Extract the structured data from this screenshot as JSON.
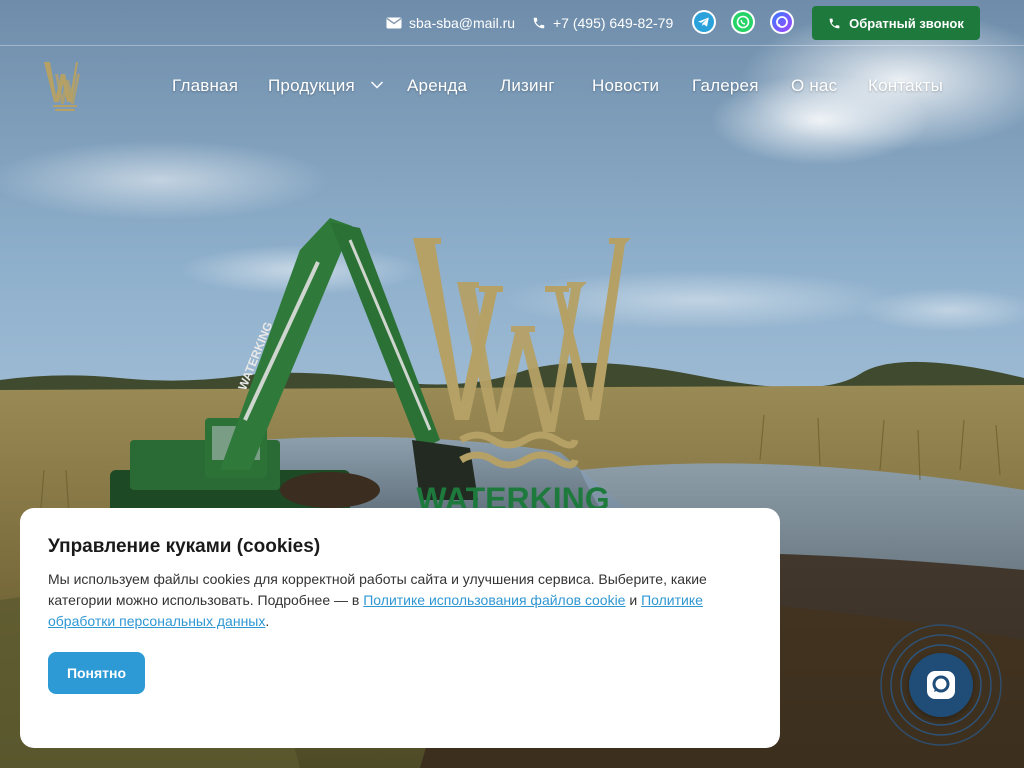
{
  "topbar": {
    "email": "sba-sba@mail.ru",
    "phone": "+7 (495) 649-82-79",
    "callback_label": "Обратный звонок",
    "icons": [
      "mail-icon",
      "phone-icon",
      "telegram-icon",
      "whatsapp-icon",
      "max-messenger-icon"
    ]
  },
  "nav": {
    "items": [
      {
        "label": "Главная"
      },
      {
        "label": "Продукция",
        "has_dropdown": true
      },
      {
        "label": "Аренда"
      },
      {
        "label": "Лизинг"
      },
      {
        "label": "Новости"
      },
      {
        "label": "Галерея"
      },
      {
        "label": "О нас"
      },
      {
        "label": "Контакты"
      }
    ]
  },
  "hero": {
    "logo_text": "WATERKING",
    "excavator_text": "WATERKING"
  },
  "cookie": {
    "title": "Управление куками (cookies)",
    "text_before": "Мы используем файлы cookies для корректной работы сайта и улучшения сервиса. Выберите, какие категории можно использовать. Подробнее — в ",
    "link_cookie": "Политике использования файлов cookie",
    "text_middle": " и ",
    "link_privacy": "Политике обработки персональных данных",
    "text_after": ".",
    "button_label": "Понятно"
  },
  "colors": {
    "brand_green": "#1e7a3c",
    "logo_gold": "#b5a065",
    "link_blue": "#2f97d3",
    "button_blue": "#2d9ad5",
    "chat_navy": "#1f4d78"
  }
}
